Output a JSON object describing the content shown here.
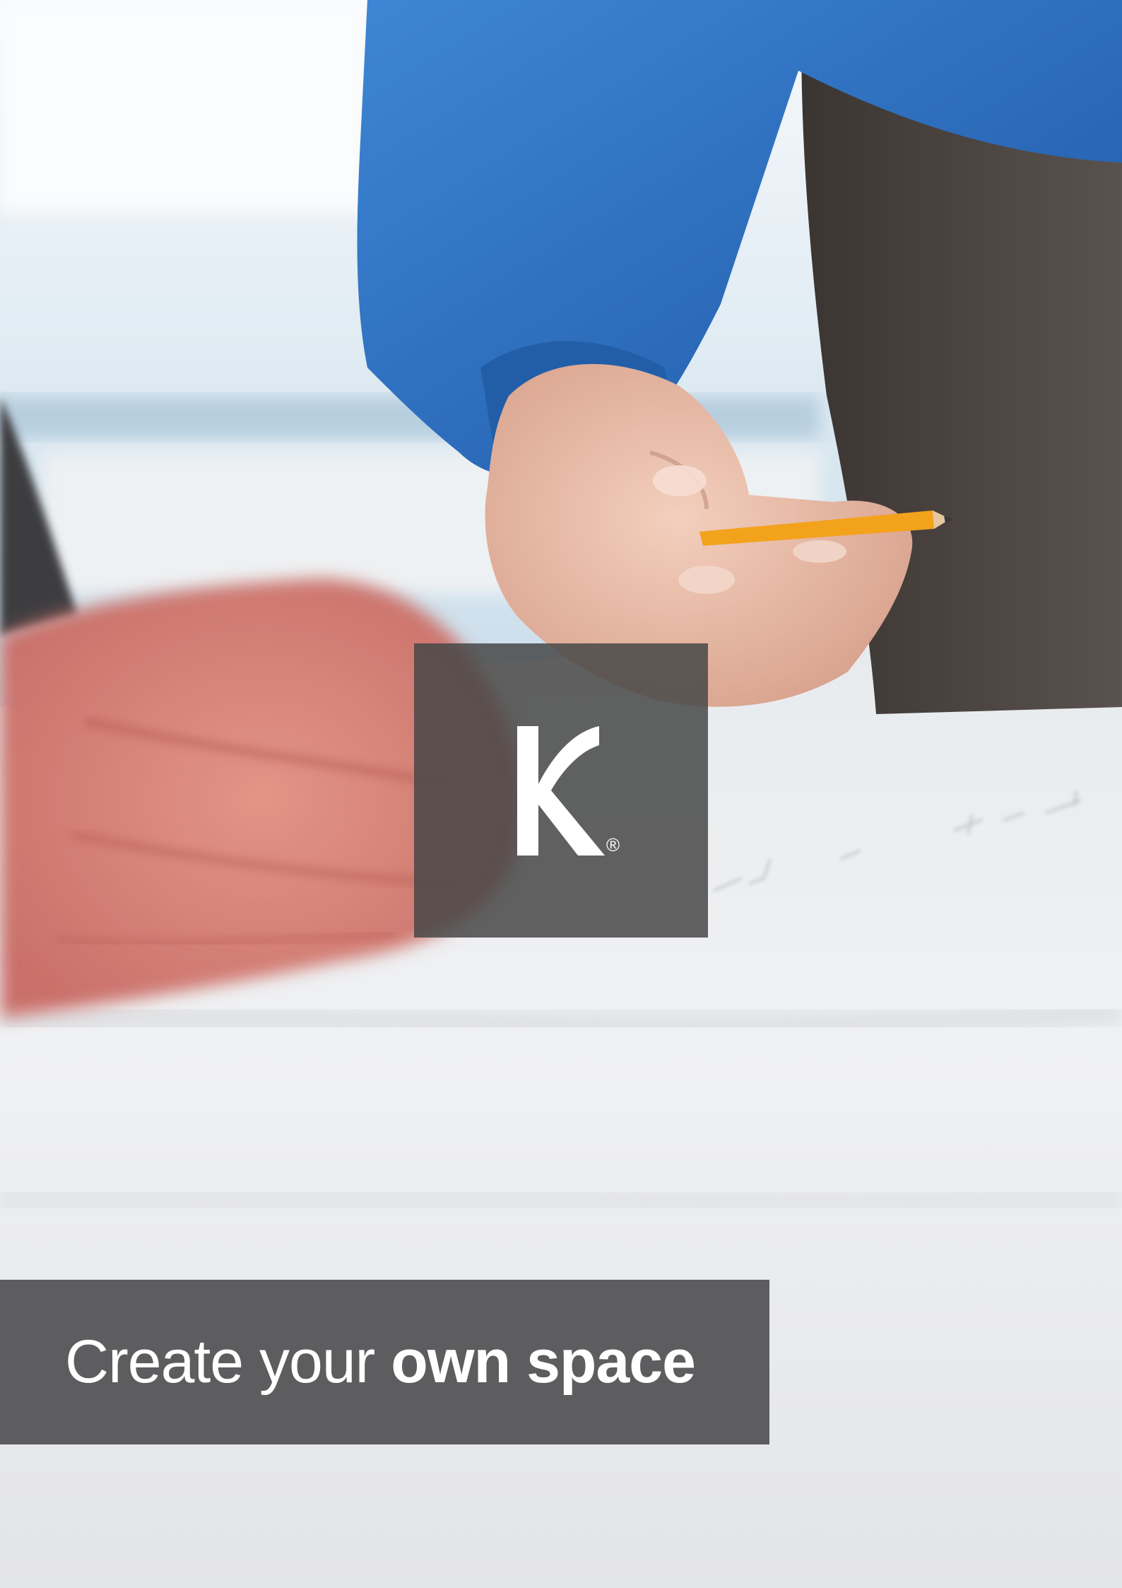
{
  "cover": {
    "photo_icon": "photo-icon",
    "logo": {
      "letter": "K",
      "registered_mark": "®"
    },
    "tagline": {
      "light": "Create your ",
      "bold": "own space"
    }
  },
  "colors": {
    "overlay": "#484848",
    "banner": "#4e4e50",
    "text": "#ffffff",
    "shirt": "#2f74c4",
    "pencil": "#f3a21c"
  }
}
